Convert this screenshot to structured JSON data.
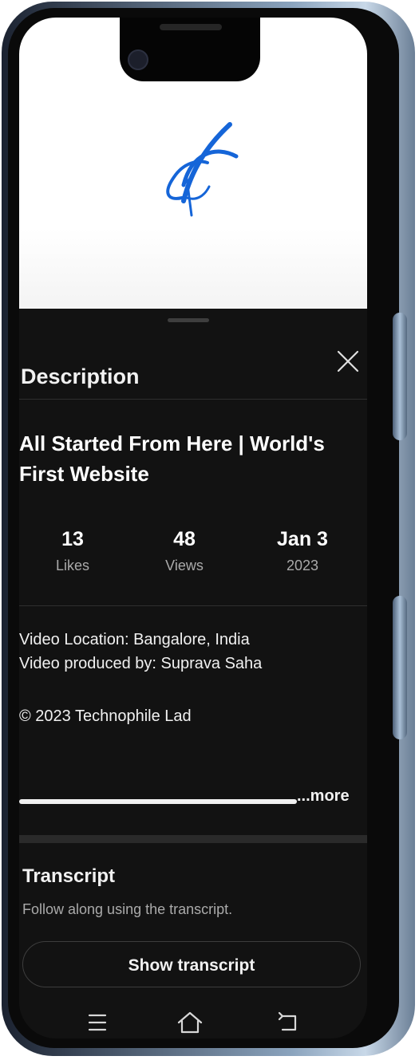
{
  "description_sheet": {
    "title": "Description",
    "video_title": "All Started From Here | World's First Website",
    "stats": [
      {
        "value": "13",
        "label": "Likes"
      },
      {
        "value": "48",
        "label": "Views"
      },
      {
        "value": "Jan 3",
        "label": "2023"
      }
    ],
    "description_lines": [
      "Video Location: Bangalore, India",
      "Video produced by: Suprava Saha"
    ],
    "copyright": "© 2023 Technophile Lad",
    "more_label": "...more"
  },
  "transcript": {
    "title": "Transcript",
    "subtitle": "Follow along using the transcript.",
    "button_label": "Show transcript"
  },
  "icons": {
    "close": "close-icon",
    "menu": "menu-icon",
    "home": "home-icon",
    "back": "back-icon",
    "logo": "channel-logo"
  },
  "colors": {
    "sheet_background": "#121212",
    "logo_blue": "#1565d8",
    "primary_text": "#f1f1f1",
    "secondary_text": "#aaaaaa"
  }
}
